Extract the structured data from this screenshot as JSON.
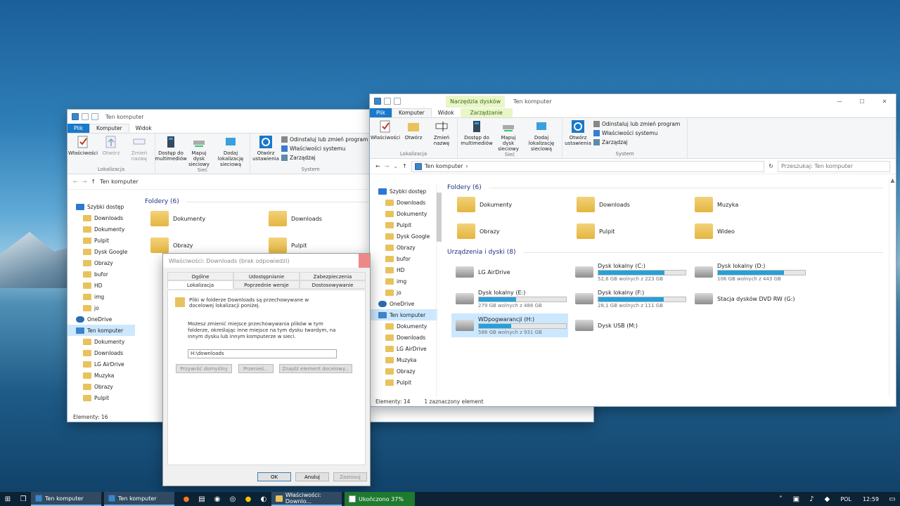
{
  "computer_label": "Ten komputer",
  "tabs": {
    "file": "Plik",
    "computer": "Komputer",
    "view": "Widok",
    "tools": "Narzędzia dysków",
    "manage": "Zarządzanie"
  },
  "ribbon": {
    "properties": "Właściwości",
    "open": "Otwórz",
    "rename": "Zmień nazwę",
    "location_cap": "Lokalizacja",
    "media": "Dostęp do multimediów",
    "map": "Mapuj dysk sieciowy",
    "addloc": "Dodaj lokalizację sieciową",
    "net_cap": "Sieć",
    "settings": "Otwórz ustawienia",
    "uninstall": "Odinstaluj lub zmień program",
    "sysprops": "Właściwości systemu",
    "manage": "Zarządzaj",
    "system_cap": "System"
  },
  "search_placeholder": "Przeszukaj: Ten komputer",
  "nav_front": [
    "Szybki dostęp",
    "Downloads",
    "Dokumenty",
    "Pulpit",
    "Dysk Google",
    "Obrazy",
    "bufor",
    "HD",
    "img",
    "jo",
    "OneDrive",
    "Ten komputer",
    "Dokumenty",
    "Downloads",
    "LG AirDrive",
    "Muzyka",
    "Obrazy",
    "Pulpit"
  ],
  "nav_back": [
    "Szybki dostęp",
    "Downloads",
    "Dokumenty",
    "Pulpit",
    "Dysk Google",
    "Obrazy",
    "bufor",
    "HD",
    "img",
    "jo",
    "OneDrive",
    "Ten komputer",
    "Dokumenty",
    "Downloads",
    "LG AirDrive",
    "Muzyka",
    "Obrazy",
    "Pulpit"
  ],
  "folders_section": "Foldery (6)",
  "folders": [
    "Dokumenty",
    "Downloads",
    "Muzyka",
    "Obrazy",
    "Pulpit",
    "Wideo"
  ],
  "drives_section": "Urządzenia i dyski (8)",
  "drives": [
    {
      "name": "LG AirDrive",
      "free": "",
      "used": null
    },
    {
      "name": "Dysk lokalny (C:)",
      "free": "52,6 GB wolnych z 223 GB",
      "used": 0.76
    },
    {
      "name": "Dysk lokalny (D:)",
      "free": "106 GB wolnych z 443 GB",
      "used": 0.76
    },
    {
      "name": "Dysk lokalny (E:)",
      "free": "279 GB wolnych z 488 GB",
      "used": 0.43
    },
    {
      "name": "Dysk lokalny (F:)",
      "free": "28,1 GB wolnych z 111 GB",
      "used": 0.75
    },
    {
      "name": "Stacja dysków DVD RW (G:)",
      "free": "",
      "used": null
    },
    {
      "name": "WDpogwarancji (H:)",
      "free": "586 GB wolnych z 931 GB",
      "used": 0.37
    },
    {
      "name": "Dysk USB (M:)",
      "free": "",
      "used": null
    }
  ],
  "status": {
    "count": "Elementy: 14",
    "selected": "1 zaznaczony element",
    "back_count": "Elementy: 16"
  },
  "dialog": {
    "title": "Właściwości: Downloads (brak odpowiedzi)",
    "tabs_row1": [
      "Ogólne",
      "Udostępnianie",
      "Zabezpieczenia"
    ],
    "tabs_row2": [
      "Lokalizacja",
      "Poprzednie wersje",
      "Dostosowywanie"
    ],
    "info": "Pliki w folderze Downloads są przechowywane w docelowej lokalizacji poniżej.",
    "desc": "Możesz zmienić miejsce przechowywania plików w tym folderze, określając inne miejsce na tym dysku twardym, na innym dysku lub innym komputerze w sieci.",
    "path": "H:\\downloads",
    "restore": "Przywróć domyślny",
    "move": "Przenieś...",
    "find": "Znajdź element docelowy...",
    "ok": "OK",
    "cancel": "Anuluj",
    "apply": "Zastosuj"
  },
  "taskbar": {
    "items": [
      "Ten komputer",
      "Ten komputer",
      "Właściwości: Downlo...",
      "Ukończono 37%"
    ],
    "lang": "POL",
    "time": "12:59"
  }
}
